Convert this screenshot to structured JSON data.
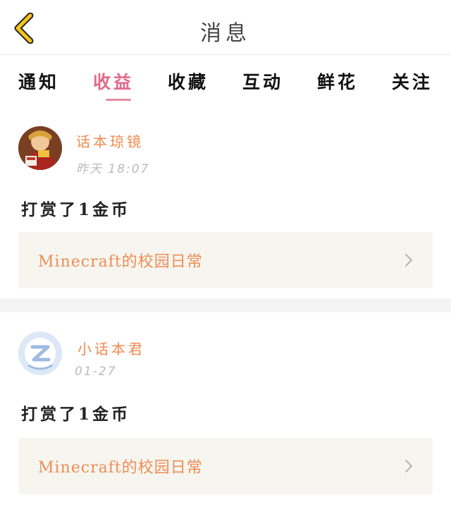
{
  "header": {
    "title": "消息"
  },
  "tabs": [
    {
      "label": "通知"
    },
    {
      "label": "收益"
    },
    {
      "label": "收藏"
    },
    {
      "label": "互动"
    },
    {
      "label": "鲜花"
    },
    {
      "label": "关注"
    }
  ],
  "active_tab": "收益",
  "messages": [
    {
      "username": "话本琼镜",
      "time": "昨天 18:07",
      "action": "打赏了1金币",
      "link": "Minecraft的校园日常"
    },
    {
      "username": "小话本君",
      "time": "01-27",
      "action": "打赏了1金币",
      "link": "Minecraft的校园日常"
    }
  ],
  "colors": {
    "accent_pink": "#e36a8d",
    "username_orange": "#f08a4e",
    "link_orange": "#ee8d55",
    "back_yellow": "#f5c518",
    "link_bg": "#f6f5ef"
  },
  "icons": {
    "back": "chevron-left-icon",
    "arrow": "chevron-right-icon"
  }
}
